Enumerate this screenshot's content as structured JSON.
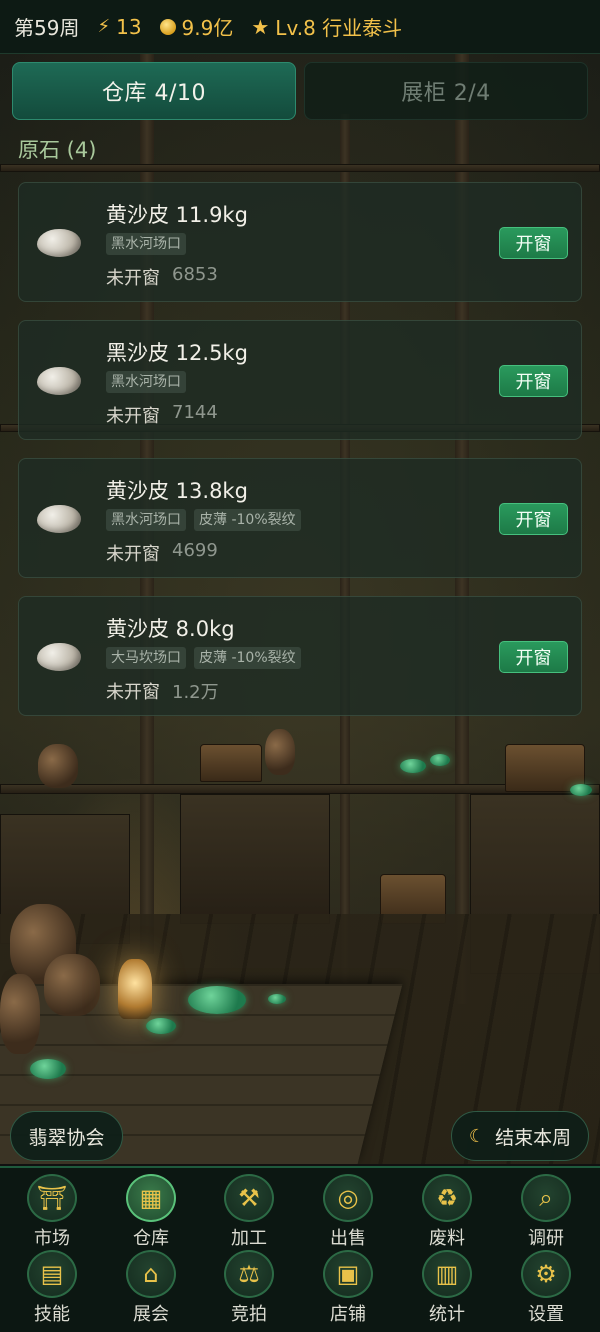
{
  "topbar": {
    "week": "第59周",
    "energy": "13",
    "coins": "9.9亿",
    "level": "Lv.8 行业泰斗"
  },
  "tabs": [
    {
      "label": "仓库 4/10",
      "active": true
    },
    {
      "label": "展柜 2/4",
      "active": false
    }
  ],
  "section_title": "原石 (4)",
  "items": [
    {
      "name": "黄沙皮 11.9kg",
      "tags": [
        "黑水河场口"
      ],
      "status": "未开窗",
      "value": "6853",
      "button": "开窗"
    },
    {
      "name": "黑沙皮 12.5kg",
      "tags": [
        "黑水河场口"
      ],
      "status": "未开窗",
      "value": "7144",
      "button": "开窗"
    },
    {
      "name": "黄沙皮 13.8kg",
      "tags": [
        "黑水河场口",
        "皮薄 -10%裂纹"
      ],
      "status": "未开窗",
      "value": "4699",
      "button": "开窗"
    },
    {
      "name": "黄沙皮 8.0kg",
      "tags": [
        "大马坎场口",
        "皮薄 -10%裂纹"
      ],
      "status": "未开窗",
      "value": "1.2万",
      "button": "开窗"
    }
  ],
  "buttons": {
    "association": "翡翠协会",
    "end_week": "结束本周"
  },
  "nav": [
    {
      "label": "市场",
      "icon": "gate-icon"
    },
    {
      "label": "仓库",
      "icon": "warehouse-icon",
      "active": true
    },
    {
      "label": "加工",
      "icon": "tools-icon"
    },
    {
      "label": "出售",
      "icon": "coin-icon"
    },
    {
      "label": "废料",
      "icon": "recycle-icon"
    },
    {
      "label": "调研",
      "icon": "magnifier-icon"
    },
    {
      "label": "技能",
      "icon": "book-icon"
    },
    {
      "label": "展会",
      "icon": "hall-icon"
    },
    {
      "label": "竞拍",
      "icon": "gavel-icon"
    },
    {
      "label": "店铺",
      "icon": "shop-icon"
    },
    {
      "label": "统计",
      "icon": "chart-icon"
    },
    {
      "label": "设置",
      "icon": "gear-icon"
    }
  ]
}
